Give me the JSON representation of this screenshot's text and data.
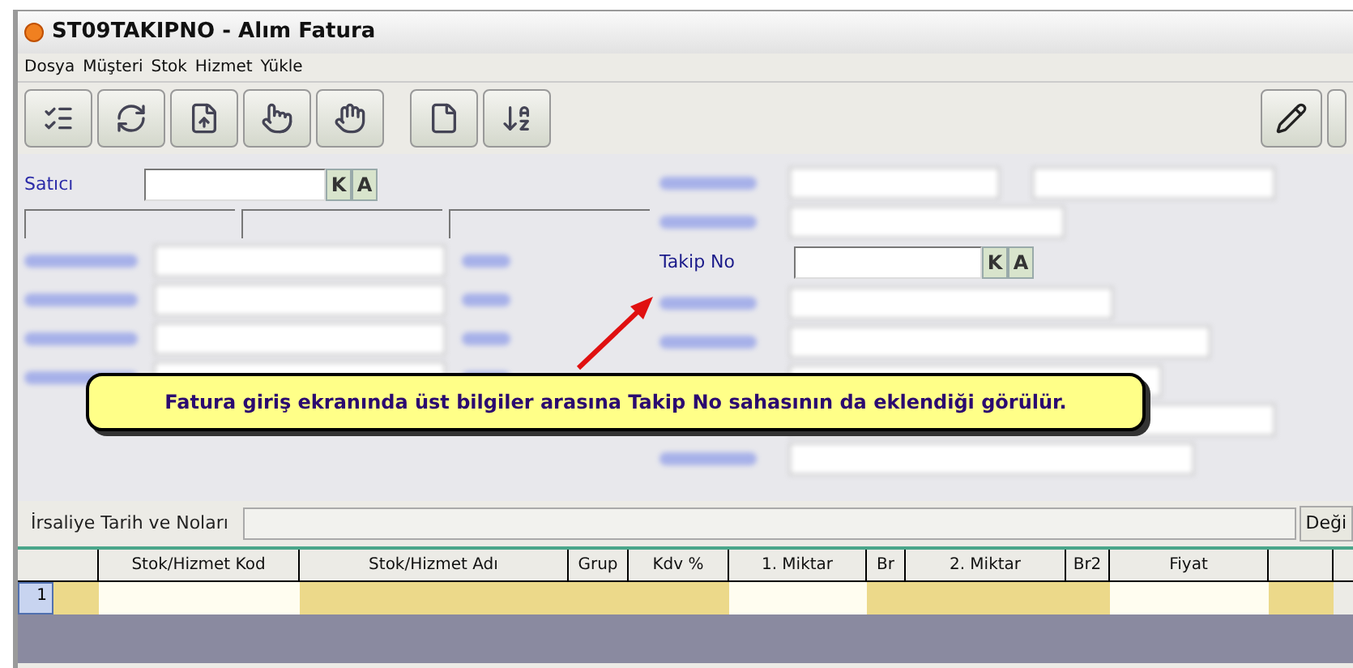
{
  "window": {
    "title": "ST09TAKIPNO - Alım Fatura"
  },
  "menu": [
    {
      "label": "Dosya"
    },
    {
      "label": "Müşteri"
    },
    {
      "label": "Stok"
    },
    {
      "label": "Hizmet"
    },
    {
      "label": "Yükle"
    }
  ],
  "form": {
    "satici": {
      "label": "Satıcı",
      "lookup": [
        "K",
        "A"
      ]
    },
    "takip_no": {
      "label": "Takip No",
      "lookup": [
        "K",
        "A"
      ]
    }
  },
  "callout": {
    "text": "Fatura giriş ekranında üst bilgiler arasına Takip No sahasının da eklendiği görülür."
  },
  "irsaliye": {
    "label": "İrsaliye Tarih ve Noları",
    "button": "Deği"
  },
  "grid": {
    "columns": [
      {
        "editable": false
      },
      {
        "label": "Stok/Hizmet Kod",
        "editable": true
      },
      {
        "label": "Stok/Hizmet Adı",
        "editable": false
      },
      {
        "label": "Grup",
        "editable": false
      },
      {
        "label": "Kdv %",
        "editable": false
      },
      {
        "label": "1. Miktar",
        "editable": true
      },
      {
        "label": "Br",
        "editable": false
      },
      {
        "label": "2. Miktar",
        "editable": false
      },
      {
        "label": "Br2",
        "editable": false
      },
      {
        "label": "Fiyat",
        "editable": true
      },
      {
        "editable": false
      }
    ],
    "rows": [
      {
        "number": "1"
      }
    ]
  }
}
